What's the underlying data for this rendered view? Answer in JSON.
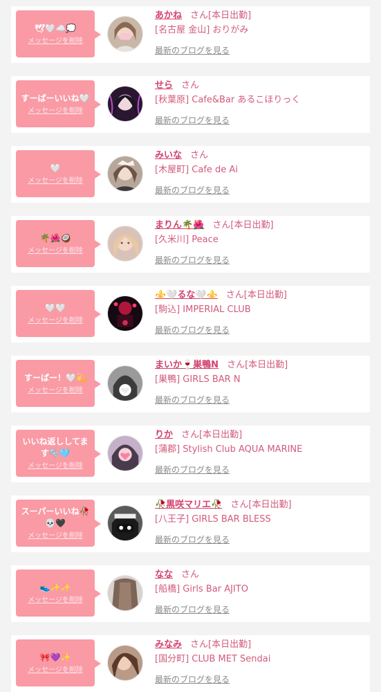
{
  "items": [
    {
      "message": "🕊🤍☁️💭",
      "delete": "メッセージを削除",
      "name": "あかね",
      "honorific": "さん",
      "status": "[本日出勤]",
      "area": "[名古屋 金山]",
      "shop": "おりがみ",
      "blog": "最新のブログを見る",
      "avatar": "avatar-photo"
    },
    {
      "message": "すーぱーいいね🤍",
      "delete": "メッセージを削除",
      "name": "せら",
      "honorific": "さん",
      "status": "",
      "area": "[秋葉原]",
      "shop": "Cafe&Bar あるこほりっく",
      "blog": "最新のブログを見る",
      "avatar": "avatar-photo"
    },
    {
      "message": "🤍",
      "delete": "メッセージを削除",
      "name": "みいな",
      "honorific": "さん",
      "status": "",
      "area": "[木屋町]",
      "shop": "Cafe de Ai",
      "blog": "最新のブログを見る",
      "avatar": "avatar-photo"
    },
    {
      "message": "🌴🌺🥥",
      "delete": "メッセージを削除",
      "name": "まりん🌴🌺",
      "honorific": "さん",
      "status": "[本日出勤]",
      "area": "[久米川]",
      "shop": "Peace",
      "blog": "最新のブログを見る",
      "avatar": "avatar-photo"
    },
    {
      "message": "🤍🤍",
      "delete": "メッセージを削除",
      "name": "⚜️🤍るな🤍⚜️",
      "honorific": "さん",
      "status": "[本日出勤]",
      "area": "[駒込]",
      "shop": "IMPERIAL CLUB",
      "blog": "最新のブログを見る",
      "avatar": "avatar-photo"
    },
    {
      "message": "すーぱー！🤍💫",
      "delete": "メッセージを削除",
      "name": "まいか🍷巣鴨N",
      "honorific": "さん",
      "status": "[本日出勤]",
      "area": "[巣鴨]",
      "shop": "GIRLS BAR N",
      "blog": "最新のブログを見る",
      "avatar": "avatar-photo"
    },
    {
      "message": "いいね返ししてます🫧🩵",
      "delete": "メッセージを削除",
      "name": "りか",
      "honorific": "さん",
      "status": "[本日出勤]",
      "area": "[蒲郡]",
      "shop": "Stylish Club AQUA MARINE",
      "blog": "最新のブログを見る",
      "avatar": "avatar-photo"
    },
    {
      "message": "スーパーいいね🥀💀🖤",
      "delete": "メッセージを削除",
      "name": "🥀黒咲マリエ🥀",
      "honorific": "さん",
      "status": "[本日出勤]",
      "area": "[八王子]",
      "shop": "GIRLS BAR BLESS",
      "blog": "最新のブログを見る",
      "avatar": "avatar-photo"
    },
    {
      "message": "👟✨✨",
      "delete": "メッセージを削除",
      "name": "なな",
      "honorific": "さん",
      "status": "",
      "area": "[船橋]",
      "shop": "Girls Bar AJITO",
      "blog": "最新のブログを見る",
      "avatar": "avatar-photo"
    },
    {
      "message": "🎀💜✨",
      "delete": "メッセージを削除",
      "name": "みなみ",
      "honorific": "さん",
      "status": "[本日出勤]",
      "area": "[国分町]",
      "shop": "CLUB MET Sendai",
      "blog": "最新のブログを見る",
      "avatar": "avatar-photo"
    }
  ],
  "colors": {
    "bubble": "#f99aa5",
    "name": "#d2416e",
    "text": "#d25a7b",
    "muted": "#8a8a8a"
  }
}
